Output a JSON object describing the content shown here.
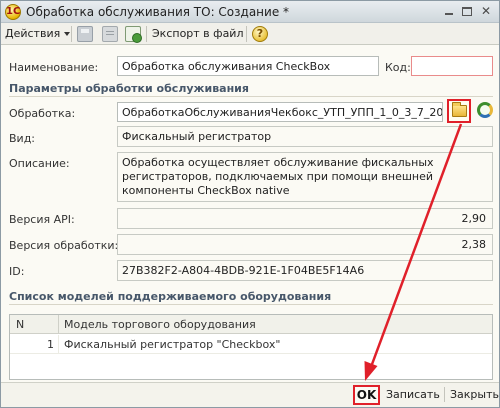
{
  "window": {
    "title": "Обработка обслуживания ТО: Создание *",
    "app_icon_glyph": "1С"
  },
  "toolbar": {
    "actions_label": "Действия",
    "export_label": "Экспорт в файл",
    "help_glyph": "?"
  },
  "form": {
    "name_label": "Наименование:",
    "name_value": "Обработка обслуживания CheckBox",
    "code_label": "Код:",
    "code_value": "",
    "section_params": "Параметры обработки обслуживания",
    "processing_label": "Обработка:",
    "processing_value": "ОбработкаОбслуживанияЧекбокс_УТП_УПП_1_0_3_7_20",
    "type_label": "Вид:",
    "type_value": "Фискальный регистратор",
    "description_label": "Описание:",
    "description_value": "Обработка осуществляет обслуживание фискальных регистраторов, подключаемых при помощи внешней компоненты CheckBox native",
    "api_label": "Версия API:",
    "api_value": "2,90",
    "version_label": "Версия обработки:",
    "version_value": "2,38",
    "id_label": "ID:",
    "id_value": "27B382F2-A804-4BDB-921E-1F04BE5F14A6",
    "section_models": "Список моделей поддерживаемого оборудования"
  },
  "models_table": {
    "columns": [
      "N",
      "Модель торгового оборудования"
    ],
    "rows": [
      {
        "n": "1",
        "model": "Фискальный регистратор \"Checkbox\""
      }
    ]
  },
  "footer": {
    "ok_label": "OK",
    "write_label": "Записать",
    "close_label": "Закрыть"
  },
  "icons": {
    "select_file": "folder-icon",
    "refresh": "refresh-icon",
    "help": "help-icon"
  },
  "colors": {
    "highlight_red": "#e0202a",
    "section_title": "#47576a"
  }
}
